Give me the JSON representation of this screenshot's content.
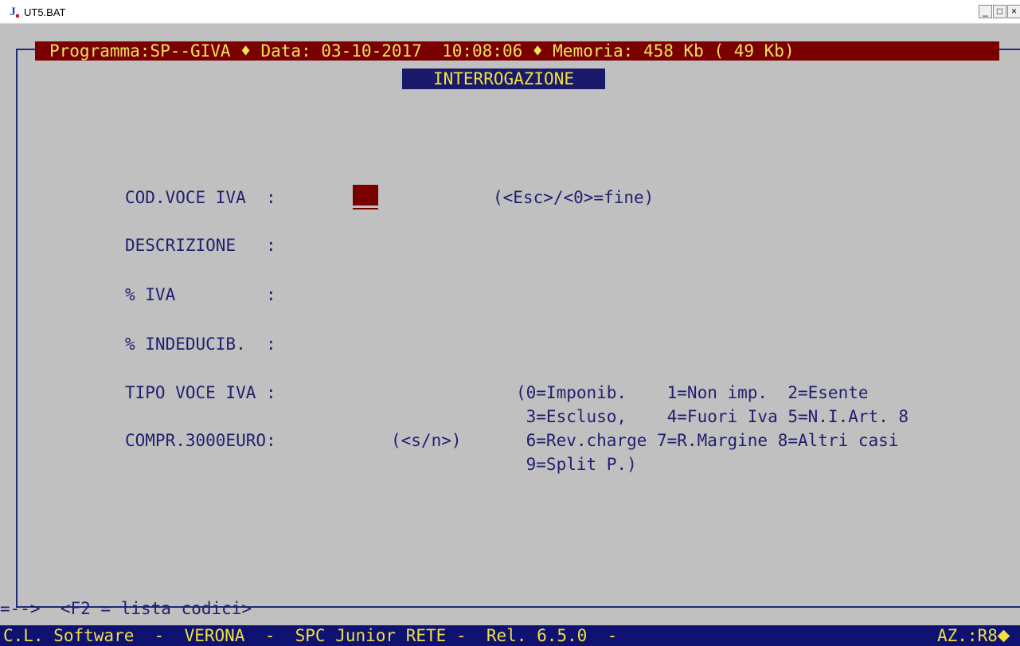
{
  "window": {
    "title": "UT5.BAT",
    "buttons": {
      "minimize": "_",
      "maximize": "□",
      "close": "×"
    }
  },
  "header": {
    "text": "Programma:SP--GIVA ♦ Data: 03-10-2017  10:08:06 ♦ Memoria: 458 Kb ( 49 Kb)"
  },
  "screen_title": "INTERROGAZIONE",
  "fields": [
    {
      "label": "COD.VOCE IVA  :",
      "note": "(<Esc>/<0>=fine)"
    },
    {
      "label": "DESCRIZIONE   :"
    },
    {
      "label": "% IVA         :"
    },
    {
      "label": "% INDEDUCIB.  :"
    },
    {
      "label": "TIPO VOCE IVA :"
    },
    {
      "label": "COMPR.3000EURO:",
      "note": "(<s/n>)"
    }
  ],
  "tipo_options": [
    "(0=Imponib.    1=Non imp.  2=Esente",
    " 3=Escluso,    4=Fuori Iva 5=N.I.Art. 8",
    " 6=Rev.charge 7=R.Margine 8=Altri casi",
    " 9=Split P.)"
  ],
  "hint": "=-->  <F2 = lista codici>",
  "status": {
    "left": "C.L. Software  -  VERONA  -  SPC Junior RETE -  Rel. 6.5.0  -",
    "right": "AZ.:R8"
  },
  "colors": {
    "background": "#c0c0c0",
    "text": "#202070",
    "header_bg": "#7a0000",
    "header_fg": "#f0e060",
    "status_bg": "#0f1270",
    "status_fg": "#f0e040"
  }
}
